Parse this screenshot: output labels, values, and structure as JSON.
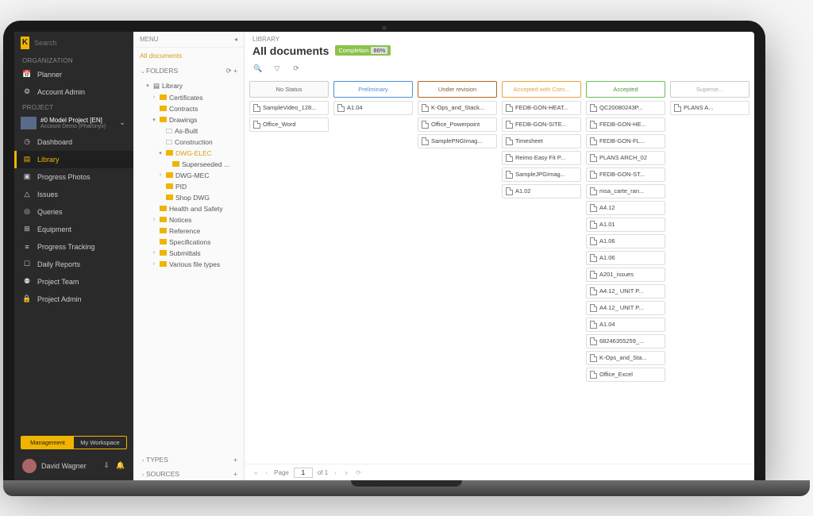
{
  "logo_text": "K",
  "search_placeholder": "Search",
  "sidebar": {
    "org_label": "ORGANIZATION",
    "org_items": [
      {
        "icon": "calendar-icon",
        "label": "Planner"
      },
      {
        "icon": "gear-icon",
        "label": "Account Admin"
      }
    ],
    "proj_label": "PROJECT",
    "project_name": "#0 Model Project [EN]",
    "project_sub": "Account Demo (Pharonyx)",
    "proj_items": [
      {
        "icon": "dashboard-icon",
        "label": "Dashboard"
      },
      {
        "icon": "library-icon",
        "label": "Library"
      },
      {
        "icon": "photos-icon",
        "label": "Progress Photos"
      },
      {
        "icon": "warning-icon",
        "label": "Issues"
      },
      {
        "icon": "pin-icon",
        "label": "Queries"
      },
      {
        "icon": "equipment-icon",
        "label": "Equipment"
      },
      {
        "icon": "tracking-icon",
        "label": "Progress Tracking"
      },
      {
        "icon": "report-icon",
        "label": "Daily Reports"
      },
      {
        "icon": "team-icon",
        "label": "Project Team"
      },
      {
        "icon": "lock-icon",
        "label": "Project Admin"
      }
    ],
    "management": "Management",
    "workspace": "My Workspace",
    "user": "David Wagner"
  },
  "tree": {
    "menu_label": "MENU",
    "all_docs": "All documents",
    "folders_label": "FOLDERS",
    "types_label": "TYPES",
    "sources_label": "SOURCES",
    "nodes": {
      "library": "Library",
      "certificates": "Certificates",
      "contracts": "Contracts",
      "drawings": "Drawings",
      "asbuilt": "As-Built",
      "construction": "Construction",
      "dwgelec": "DWG-ELEC",
      "superseeded": "Superseeded ...",
      "dwgmec": "DWG-MEC",
      "pid": "PID",
      "shopdwg": "Shop DWG",
      "health": "Health and Safety",
      "notices": "Notices",
      "reference": "Reference",
      "specs": "Specifications",
      "submittals": "Submittals",
      "various": "Various file types"
    }
  },
  "main": {
    "breadcrumb": "LIBRARY",
    "title": "All documents",
    "completion_label": "Completion",
    "completion_pct": "86%",
    "columns": [
      {
        "name": "No Status",
        "cls": "c-none",
        "cards": [
          "SampleVideo_128...",
          "Office_Word"
        ]
      },
      {
        "name": "Preliminary",
        "cls": "c-prelim",
        "cards": [
          "A1.04"
        ]
      },
      {
        "name": "Under revision",
        "cls": "c-rev",
        "cards": [
          "K-Ops_and_Stack...",
          "Office_Powerpoint",
          "SamplePNGImag..."
        ]
      },
      {
        "name": "Accepted with Com...",
        "cls": "c-accom",
        "cards": [
          "FEDB-GON-HEAT...",
          "FEDB-GON-SITE...",
          "Timesheet",
          "Reimo Easy Fit P...",
          "SampleJPGImag...",
          "A1.02"
        ]
      },
      {
        "name": "Accepted",
        "cls": "c-acc",
        "cards": [
          "QC20080243P...",
          "FEDB-GON-HE...",
          "FEDB-GON-FL...",
          "PLANS ARCH_02",
          "FEDB-GON-ST...",
          "msa_carte_ran...",
          "A4.12",
          "A1.01",
          "A1.06",
          "A1.06",
          "A201_issues",
          "A4.12_ UNIT P...",
          "A4.12_ UNIT P...",
          "A1.04",
          "68246355259_...",
          "K-Ops_and_Sta...",
          "Office_Excel"
        ]
      },
      {
        "name": "Superse...",
        "cls": "c-sup",
        "cards": [
          "PLANS A..."
        ]
      }
    ],
    "pager": {
      "page_label": "Page",
      "page": "1",
      "of": "of 1"
    }
  }
}
